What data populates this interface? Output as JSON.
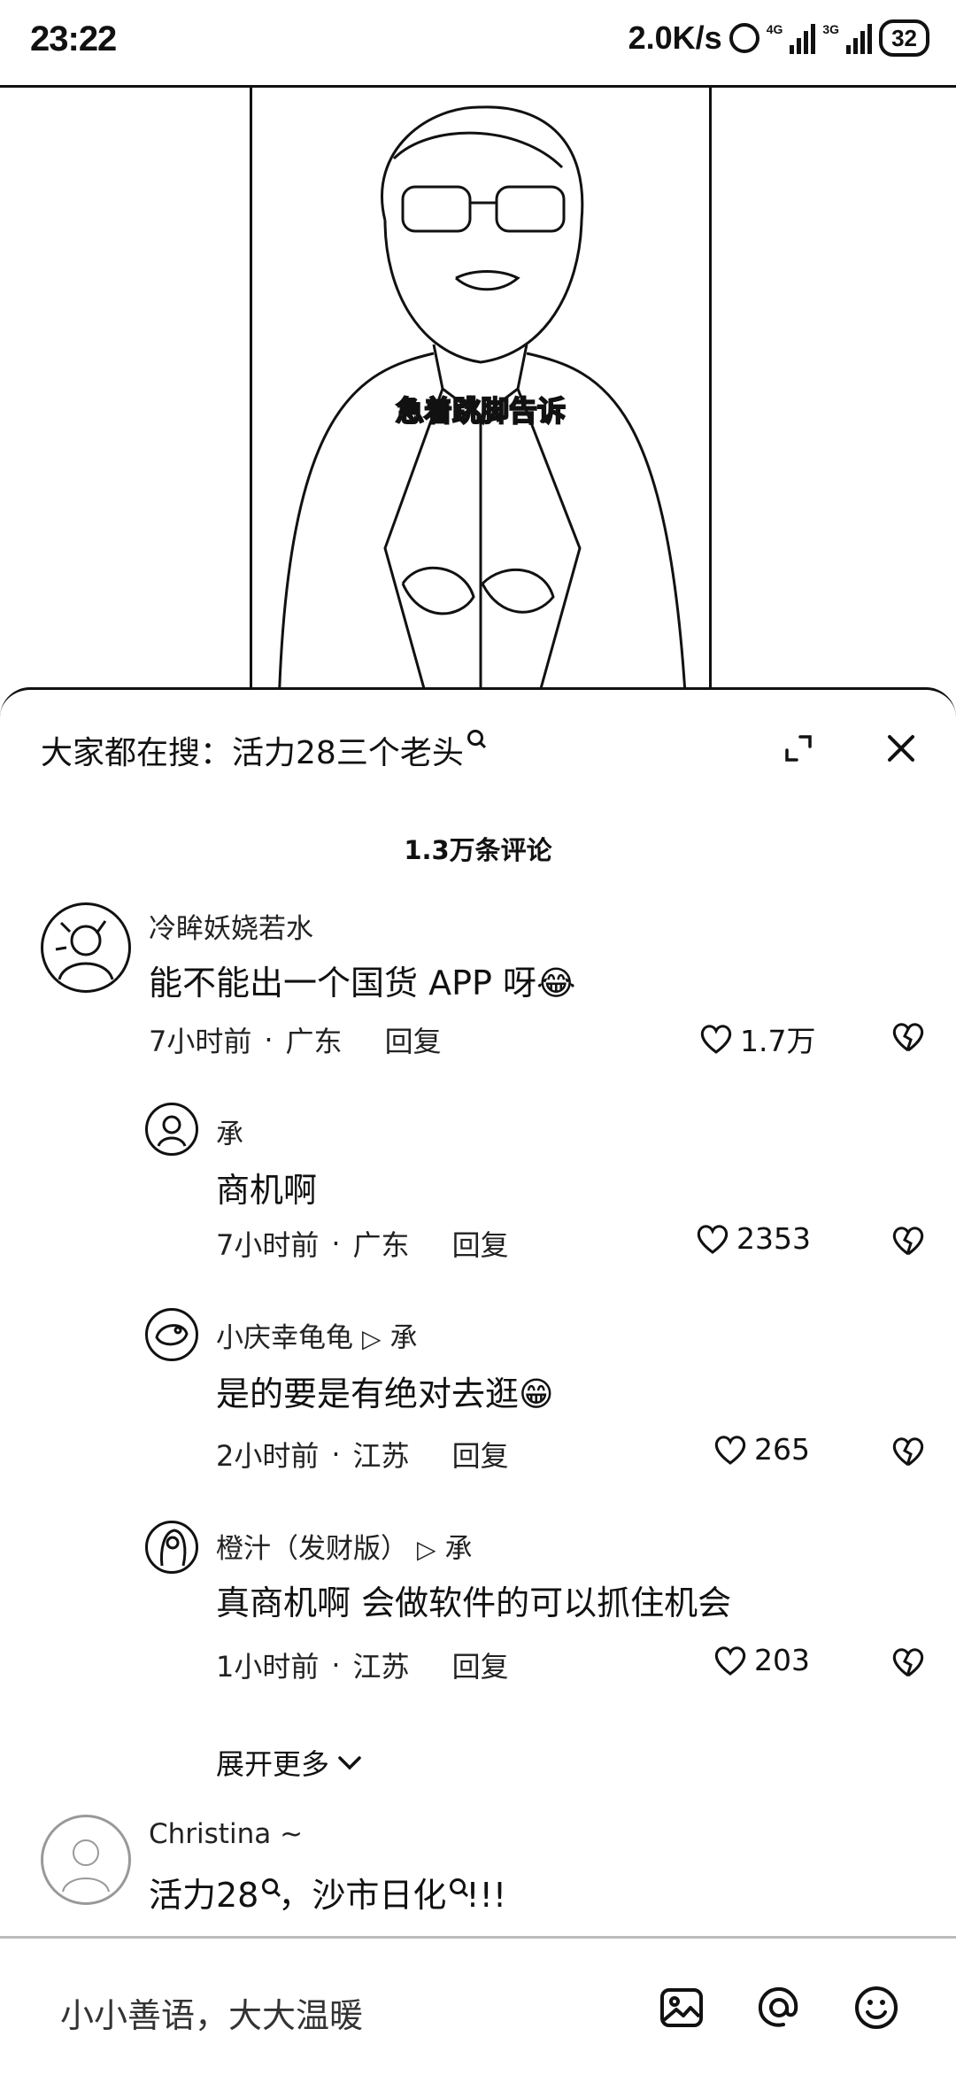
{
  "status": {
    "time": "23:22",
    "speed": "2.0K/s",
    "net1": "4G",
    "net2": "3G",
    "battery": "32"
  },
  "video": {
    "caption": "急着跳脚告诉"
  },
  "sheet": {
    "search_prefix": "大家都在搜：",
    "search_term": "活力28三个老头",
    "comment_count": "1.3万条评论",
    "input_placeholder": "小小善语，大大温暖"
  },
  "comments": [
    {
      "name": "冷眸妖娆若水",
      "text": "能不能出一个国货 APP 呀",
      "emoji": "😂",
      "time": "7小时前",
      "location": "广东",
      "reply_label": "回复",
      "likes": "1.7万"
    },
    {
      "name": "承",
      "text": "商机啊",
      "time": "7小时前",
      "location": "广东",
      "reply_label": "回复",
      "likes": "2353"
    },
    {
      "name": "小庆幸龟龟",
      "reply_to": "承",
      "text": "是的要是有绝对去逛",
      "emoji": "😁",
      "time": "2小时前",
      "location": "江苏",
      "reply_label": "回复",
      "likes": "265"
    },
    {
      "name": "橙汁（发财版）",
      "reply_to": "承",
      "text": "真商机啊 会做软件的可以抓住机会",
      "time": "1小时前",
      "location": "江苏",
      "reply_label": "回复",
      "likes": "203"
    },
    {
      "name": "Christina ~",
      "text_a": "活力28",
      "text_b": "，沙市日化",
      "text_c": "!!!"
    }
  ],
  "expand_more": "展开更多"
}
